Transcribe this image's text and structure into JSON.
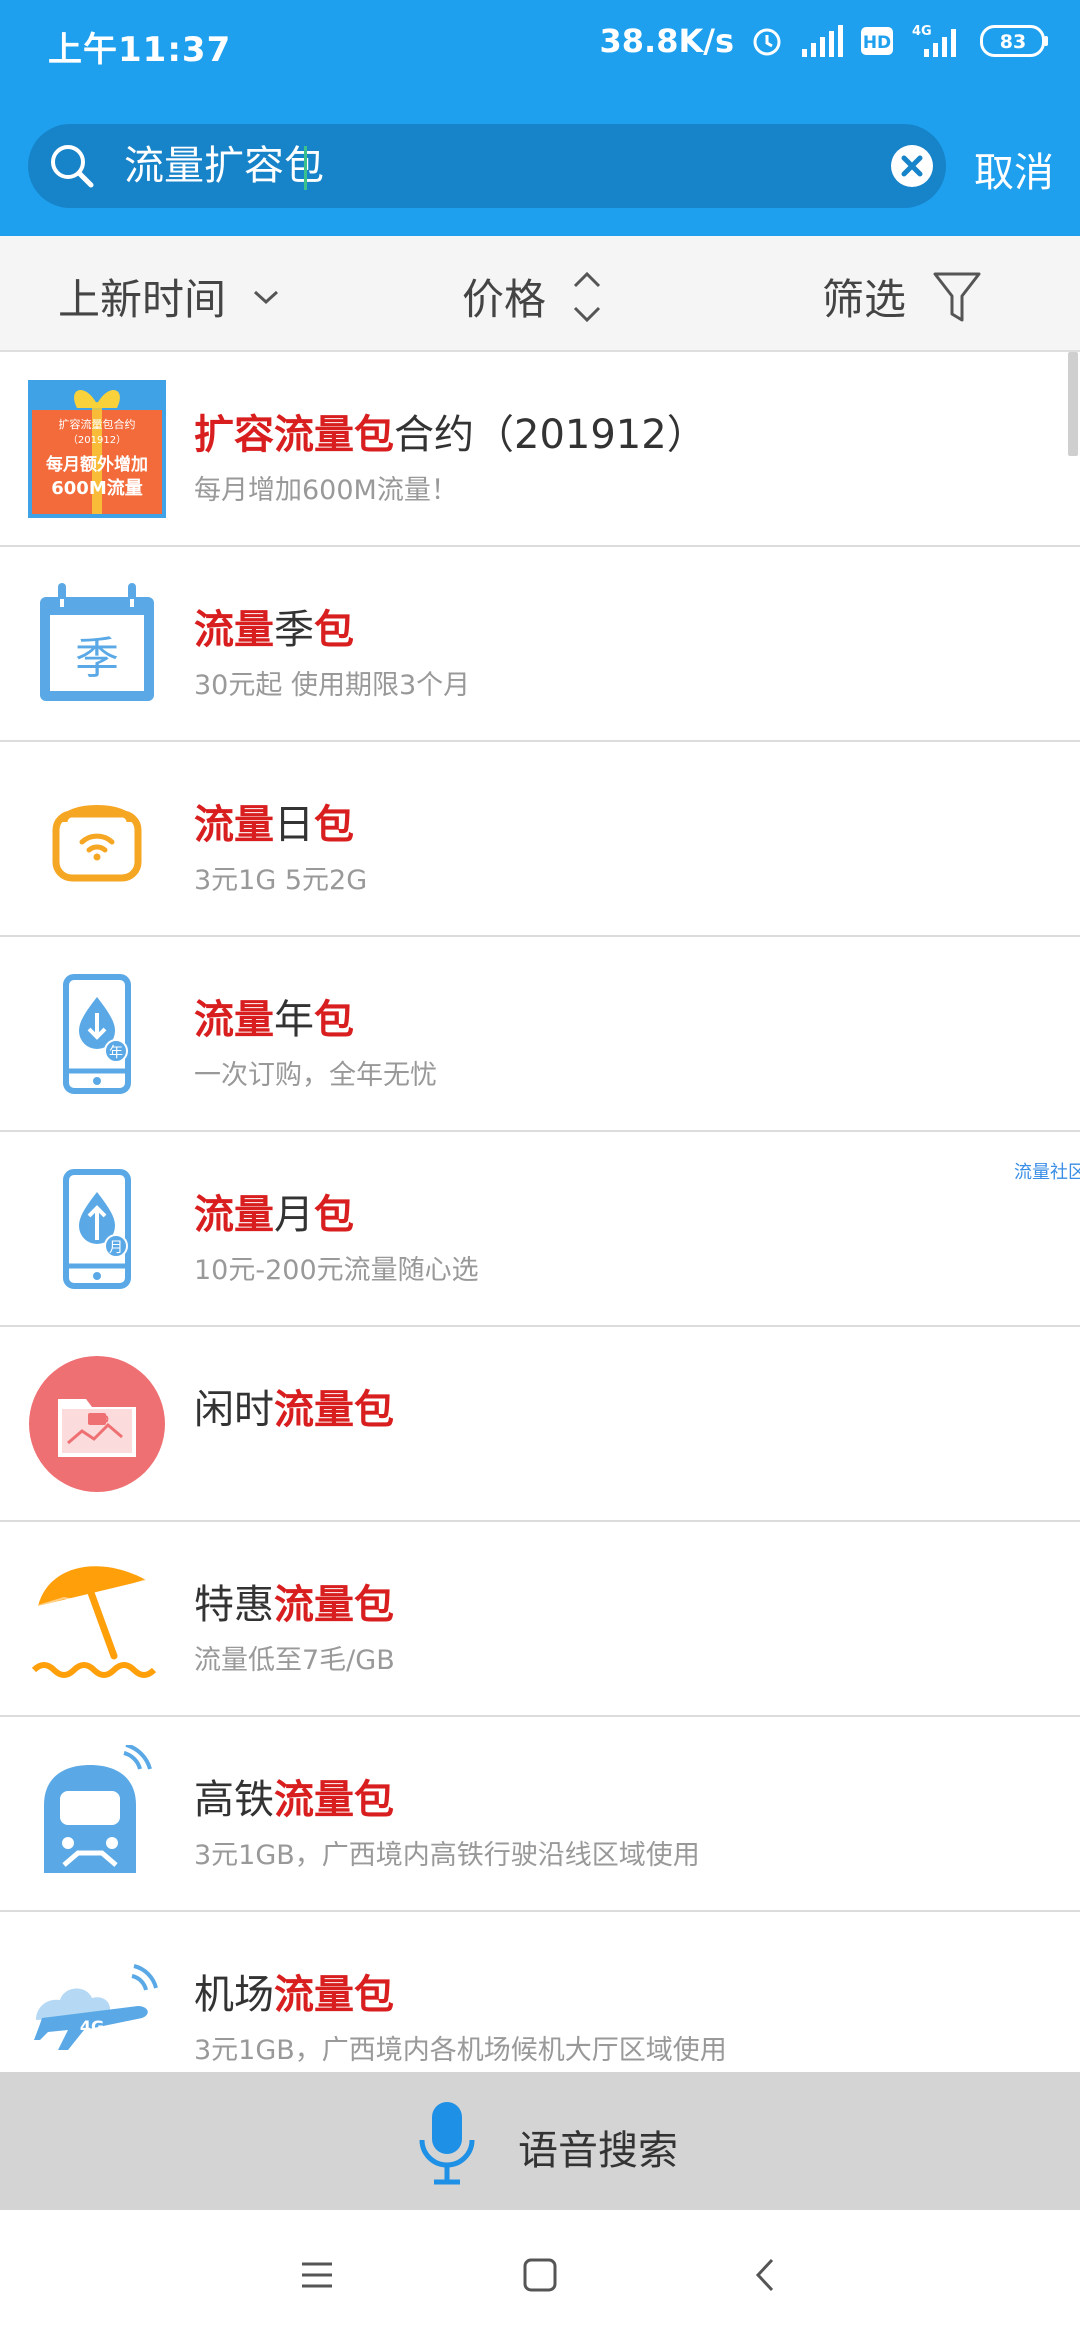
{
  "status": {
    "time": "上午11:37",
    "net_speed": "38.8K/s",
    "hd_label": "HD",
    "network_label": "4G",
    "battery": "83"
  },
  "search": {
    "query": "流量扩容包",
    "cancel_label": "取消"
  },
  "filters": {
    "sort_new": "上新时间",
    "price": "价格",
    "filter": "筛选"
  },
  "items": [
    {
      "hl1": "扩容流量包",
      "mid": "合约（201912）",
      "hl2": "",
      "end": "",
      "sub": "每月增加600M流量！",
      "icon": "promo-badge-icon",
      "badge": {
        "l1": "扩容流量包合约",
        "l2": "（201912）",
        "l3": "每月额外增加",
        "l4": "600M流量"
      }
    },
    {
      "hl1": "流量",
      "mid": "季",
      "hl2": "包",
      "end": "",
      "sub": "30元起 使用期限3个月",
      "icon": "calendar-icon",
      "cal_char": "季"
    },
    {
      "hl1": "流量",
      "mid": "日",
      "hl2": "包",
      "end": "",
      "sub": "3元1G 5元2G",
      "icon": "wifi-bag-icon"
    },
    {
      "hl1": "流量",
      "mid": "年",
      "hl2": "包",
      "end": "",
      "sub": "一次订购，全年无忧",
      "icon": "phone-year-icon",
      "tag": "年"
    },
    {
      "hl1": "流量",
      "mid": "月",
      "hl2": "包",
      "end": "",
      "sub": "10元-200元流量随心选",
      "icon": "phone-month-icon",
      "tag": "月"
    },
    {
      "pre": "闲时",
      "hl1": "流量包",
      "sub": "",
      "icon": "leisure-folder-icon"
    },
    {
      "pre": "特惠",
      "hl1": "流量包",
      "sub": "流量低至7毛/GB",
      "icon": "umbrella-icon"
    },
    {
      "pre": "高铁",
      "hl1": "流量包",
      "sub": "3元1GB，广西境内高铁行驶沿线区域使用",
      "icon": "train-icon"
    },
    {
      "pre": "机场",
      "hl1": "流量包",
      "sub": "3元1GB，广西境内各机场候机大厅区域使用",
      "icon": "airplane-icon",
      "plane_tag": "4G"
    }
  ],
  "side_label": "流量社区",
  "voice": {
    "label": "语音搜索"
  },
  "colors": {
    "header_blue": "#1ea0ee",
    "highlight_red": "#d81e1e",
    "icon_blue": "#5aa9e6",
    "icon_orange": "#f5a623"
  }
}
